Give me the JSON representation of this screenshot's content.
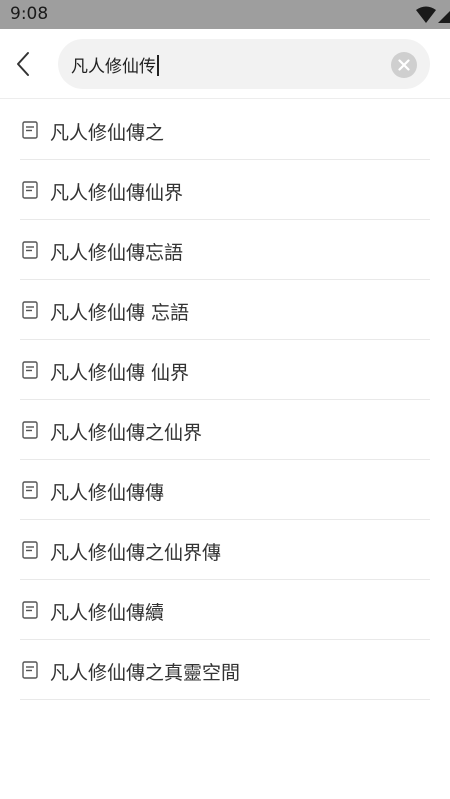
{
  "status_bar": {
    "time": "9:08"
  },
  "header": {
    "back_icon": "chevron-left-icon",
    "search": {
      "value": "凡人修仙传",
      "clear_icon": "clear-circle-icon"
    }
  },
  "results": {
    "item_icon": "document-icon",
    "items": [
      {
        "label": "凡人修仙傳之"
      },
      {
        "label": "凡人修仙傳仙界"
      },
      {
        "label": "凡人修仙傳忘語"
      },
      {
        "label": "凡人修仙傳 忘語"
      },
      {
        "label": "凡人修仙傳 仙界"
      },
      {
        "label": "凡人修仙傳之仙界"
      },
      {
        "label": "凡人修仙傳傳"
      },
      {
        "label": "凡人修仙傳之仙界傳"
      },
      {
        "label": "凡人修仙傳續"
      },
      {
        "label": "凡人修仙傳之真靈空間"
      }
    ]
  },
  "colors": {
    "status_bar_bg": "#9e9e9e",
    "search_bg": "#f2f2f2",
    "divider": "#e9e9e9",
    "text": "#333333"
  }
}
